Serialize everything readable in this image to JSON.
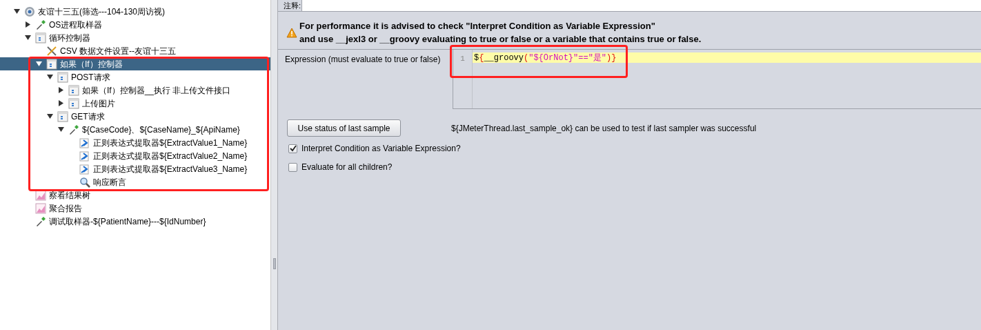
{
  "tree": [
    {
      "kind": "thread-group",
      "label": "友谊十三五(筛选---104-130周访视)",
      "expanded": true,
      "selected": false,
      "children": [
        {
          "kind": "sampler",
          "label": "OS进程取样器",
          "expanded": false,
          "selected": false
        },
        {
          "kind": "controller",
          "label": "循环控制器",
          "expanded": true,
          "selected": false,
          "children": [
            {
              "kind": "config",
              "label": "CSV 数据文件设置--友谊十三五",
              "selected": false
            },
            {
              "kind": "controller",
              "label": "如果（If）控制器",
              "expanded": true,
              "selected": true,
              "children": [
                {
                  "kind": "controller",
                  "label": "POST请求",
                  "expanded": true,
                  "selected": false,
                  "children": [
                    {
                      "kind": "controller",
                      "label": "如果（If）控制器__执行 非上传文件接口",
                      "expanded": false,
                      "selected": false
                    },
                    {
                      "kind": "controller",
                      "label": "上传图片",
                      "expanded": false,
                      "selected": false
                    }
                  ]
                },
                {
                  "kind": "controller",
                  "label": "GET请求",
                  "expanded": true,
                  "selected": false,
                  "children": [
                    {
                      "kind": "sampler",
                      "label": "${CaseCode}、${CaseName}_${ApiName}",
                      "expanded": true,
                      "selected": false,
                      "children": [
                        {
                          "kind": "extractor",
                          "label": "正则表达式提取器${ExtractValue1_Name}",
                          "selected": false
                        },
                        {
                          "kind": "extractor",
                          "label": "正则表达式提取器${ExtractValue2_Name}",
                          "selected": false
                        },
                        {
                          "kind": "extractor",
                          "label": "正则表达式提取器${ExtractValue3_Name}",
                          "selected": false
                        },
                        {
                          "kind": "assertion",
                          "label": "响应断言",
                          "selected": false
                        }
                      ]
                    }
                  ]
                }
              ]
            }
          ]
        },
        {
          "kind": "listener",
          "label": "察看结果树",
          "selected": false
        },
        {
          "kind": "listener",
          "label": "聚合报告",
          "selected": false
        },
        {
          "kind": "sampler",
          "label": "调试取样器-${PatientName}---${IdNumber}",
          "selected": false
        }
      ]
    }
  ],
  "comment": {
    "label": "注释:"
  },
  "warning": {
    "lines": [
      "For performance it is advised to check \"Interpret Condition as Variable Expression\"",
      "and use __jexl3 or __groovy evaluating to true or false or a variable that contains true or false."
    ]
  },
  "expression": {
    "label": "Expression (must evaluate to true or false)",
    "line_number": "1",
    "tokens": [
      {
        "kind": "plain",
        "text": "$"
      },
      {
        "kind": "brace",
        "text": "{"
      },
      {
        "kind": "plain",
        "text": "__groovy"
      },
      {
        "kind": "brace",
        "text": "("
      },
      {
        "kind": "string",
        "text": "\"${OrNot}\"==\"是\""
      },
      {
        "kind": "brace",
        "text": ")}"
      }
    ]
  },
  "last_sample_button": "Use status of last sample",
  "hint": "${JMeterThread.last_sample_ok} can be used to test if last sampler was successful",
  "options": [
    {
      "label": "Interpret Condition as Variable Expression?",
      "checked": true
    },
    {
      "label": "Evaluate for all children?",
      "checked": false
    }
  ]
}
